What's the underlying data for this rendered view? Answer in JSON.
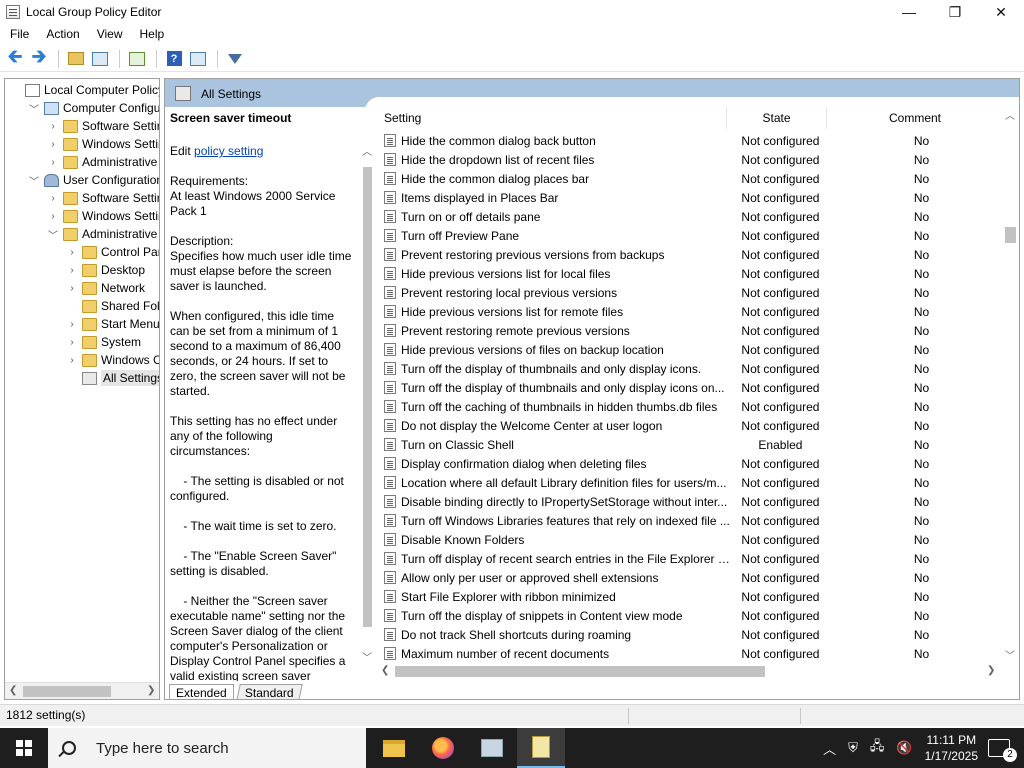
{
  "window": {
    "title": "Local Group Policy Editor",
    "controls": {
      "minimize": "—",
      "maximize": "❐",
      "close": "✕"
    }
  },
  "menu": [
    "File",
    "Action",
    "View",
    "Help"
  ],
  "tree": [
    {
      "label": "Local Computer Policy",
      "indent": 0,
      "expander": "",
      "icon": "policy",
      "selected": false
    },
    {
      "label": "Computer Configura",
      "indent": 1,
      "expander": "﹀",
      "icon": "computer",
      "selected": false
    },
    {
      "label": "Software Settings",
      "indent": 2,
      "expander": "›",
      "icon": "folder",
      "selected": false
    },
    {
      "label": "Windows Setting",
      "indent": 2,
      "expander": "›",
      "icon": "folder",
      "selected": false
    },
    {
      "label": "Administrative Te",
      "indent": 2,
      "expander": "›",
      "icon": "folder",
      "selected": false
    },
    {
      "label": "User Configuration",
      "indent": 1,
      "expander": "﹀",
      "icon": "user",
      "selected": false
    },
    {
      "label": "Software Settings",
      "indent": 2,
      "expander": "›",
      "icon": "folder",
      "selected": false
    },
    {
      "label": "Windows Setting",
      "indent": 2,
      "expander": "›",
      "icon": "folder",
      "selected": false
    },
    {
      "label": "Administrative Te",
      "indent": 2,
      "expander": "﹀",
      "icon": "folder",
      "selected": false
    },
    {
      "label": "Control Panel",
      "indent": 3,
      "expander": "›",
      "icon": "folder",
      "selected": false
    },
    {
      "label": "Desktop",
      "indent": 3,
      "expander": "›",
      "icon": "folder",
      "selected": false
    },
    {
      "label": "Network",
      "indent": 3,
      "expander": "›",
      "icon": "folder",
      "selected": false
    },
    {
      "label": "Shared Folder",
      "indent": 3,
      "expander": "",
      "icon": "folder",
      "selected": false
    },
    {
      "label": "Start Menu ar",
      "indent": 3,
      "expander": "›",
      "icon": "folder",
      "selected": false
    },
    {
      "label": "System",
      "indent": 3,
      "expander": "›",
      "icon": "folder",
      "selected": false
    },
    {
      "label": "Windows Cor",
      "indent": 3,
      "expander": "›",
      "icon": "folder",
      "selected": false
    },
    {
      "label": "All Settings",
      "indent": 3,
      "expander": "",
      "icon": "settings",
      "selected": true
    }
  ],
  "banner": {
    "title": "All Settings"
  },
  "description": {
    "title": "Screen saver timeout",
    "edit_prefix": "Edit ",
    "edit_link": "policy setting",
    "paragraphs": [
      "Requirements:\nAt least Windows 2000 Service Pack 1",
      "Description:\nSpecifies how much user idle time must elapse before the screen saver is launched.",
      "When configured, this idle time can be set from a minimum of 1 second to a maximum of 86,400 seconds, or 24 hours. If set to zero, the screen saver will not be started.",
      "This setting has no effect under any of the following circumstances:",
      "    - The setting is disabled or not configured.",
      "    - The wait time is set to zero.",
      "    - The \"Enable Screen Saver\" setting is disabled.",
      "    - Neither the \"Screen saver executable name\" setting nor the Screen Saver dialog of the client computer's Personalization or Display Control Panel specifies a valid existing screen saver program on the client."
    ]
  },
  "list": {
    "headers": {
      "setting": "Setting",
      "state": "State",
      "comment": "Comment"
    },
    "rows": [
      {
        "name": "Hide the common dialog back button",
        "state": "Not configured",
        "comment": "No"
      },
      {
        "name": "Hide the dropdown list of recent files",
        "state": "Not configured",
        "comment": "No"
      },
      {
        "name": "Hide the common dialog places bar",
        "state": "Not configured",
        "comment": "No"
      },
      {
        "name": "Items displayed in Places Bar",
        "state": "Not configured",
        "comment": "No"
      },
      {
        "name": "Turn on or off details pane",
        "state": "Not configured",
        "comment": "No"
      },
      {
        "name": "Turn off Preview Pane",
        "state": "Not configured",
        "comment": "No"
      },
      {
        "name": "Prevent restoring previous versions from backups",
        "state": "Not configured",
        "comment": "No"
      },
      {
        "name": "Hide previous versions list for local files",
        "state": "Not configured",
        "comment": "No"
      },
      {
        "name": "Prevent restoring local previous versions",
        "state": "Not configured",
        "comment": "No"
      },
      {
        "name": "Hide previous versions list for remote files",
        "state": "Not configured",
        "comment": "No"
      },
      {
        "name": "Prevent restoring remote previous versions",
        "state": "Not configured",
        "comment": "No"
      },
      {
        "name": "Hide previous versions of files on backup location",
        "state": "Not configured",
        "comment": "No"
      },
      {
        "name": "Turn off the display of thumbnails and only display icons.",
        "state": "Not configured",
        "comment": "No"
      },
      {
        "name": "Turn off the display of thumbnails and only display icons on...",
        "state": "Not configured",
        "comment": "No"
      },
      {
        "name": "Turn off the caching of thumbnails in hidden thumbs.db files",
        "state": "Not configured",
        "comment": "No"
      },
      {
        "name": "Do not display the Welcome Center at user logon",
        "state": "Not configured",
        "comment": "No"
      },
      {
        "name": "Turn on Classic Shell",
        "state": "Enabled",
        "comment": "No"
      },
      {
        "name": "Display confirmation dialog when deleting files",
        "state": "Not configured",
        "comment": "No"
      },
      {
        "name": "Location where all default Library definition files for users/m...",
        "state": "Not configured",
        "comment": "No"
      },
      {
        "name": "Disable binding directly to IPropertySetStorage without inter...",
        "state": "Not configured",
        "comment": "No"
      },
      {
        "name": "Turn off Windows Libraries features that rely on indexed file ...",
        "state": "Not configured",
        "comment": "No"
      },
      {
        "name": "Disable Known Folders",
        "state": "Not configured",
        "comment": "No"
      },
      {
        "name": "Turn off display of recent search entries in the File Explorer s...",
        "state": "Not configured",
        "comment": "No"
      },
      {
        "name": "Allow only per user or approved shell extensions",
        "state": "Not configured",
        "comment": "No"
      },
      {
        "name": "Start File Explorer with ribbon minimized",
        "state": "Not configured",
        "comment": "No"
      },
      {
        "name": "Turn off the display of snippets in Content view mode",
        "state": "Not configured",
        "comment": "No"
      },
      {
        "name": "Do not track Shell shortcuts during roaming",
        "state": "Not configured",
        "comment": "No"
      },
      {
        "name": "Maximum number of recent documents",
        "state": "Not configured",
        "comment": "No"
      }
    ]
  },
  "tabs": {
    "extended": "Extended",
    "standard": "Standard"
  },
  "status": {
    "text": "1812 setting(s)"
  },
  "taskbar": {
    "search_placeholder": "Type here to search",
    "time": "11:11 PM",
    "date": "1/17/2025",
    "notification_count": "2"
  },
  "colors": {
    "banner": "#aac4df",
    "taskbar": "#1e1e1e",
    "link": "#0645ad"
  }
}
